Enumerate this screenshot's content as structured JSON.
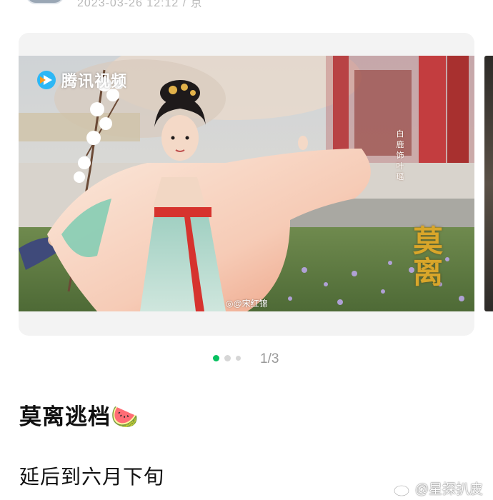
{
  "post": {
    "meta_text": "2023-03-26 12:12 / 京",
    "image_counter": {
      "current": 1,
      "total": 3,
      "label": "1/3"
    },
    "headline": "莫离逃档🍉",
    "body": "延后到六月下旬"
  },
  "photo": {
    "watermark_brand": "腾讯视频",
    "credit": "◎@宋红锦",
    "cast_caption": "白鹿饰叶瑶",
    "show_title": "莫离"
  },
  "footer": {
    "watermark": "@星探扒皮"
  },
  "colors": {
    "accent_green": "#07c160",
    "gold_title": "#d9a62a"
  }
}
